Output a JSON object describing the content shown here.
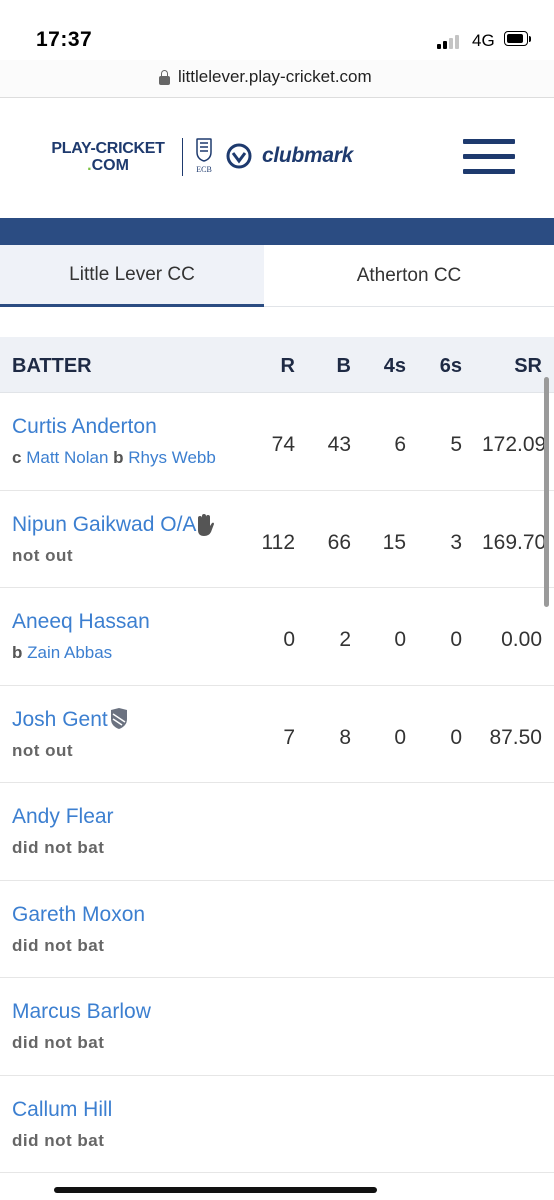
{
  "status_bar": {
    "time": "17:37",
    "network": "4G"
  },
  "browser": {
    "url": "littlelever.play-cricket.com"
  },
  "header": {
    "logo_line1": "PLAY-CRICKET",
    "logo_line2_dot": ".",
    "logo_line2": "COM",
    "ecb_text": "ECB",
    "clubmark_text": "clubmark"
  },
  "tabs": [
    {
      "label": "Little Lever CC",
      "active": true
    },
    {
      "label": "Atherton CC",
      "active": false
    }
  ],
  "table": {
    "headers": {
      "batter": "BATTER",
      "r": "R",
      "b": "B",
      "fours": "4s",
      "sixes": "6s",
      "sr": "SR"
    },
    "rows": [
      {
        "name": "Curtis Anderton",
        "dismissal": {
          "c_label": "c",
          "caught_by": "Matt Nolan",
          "b_label": "b",
          "bowler": "Rhys Webb"
        },
        "r": "74",
        "b": "43",
        "fours": "6",
        "sixes": "5",
        "sr": "172.09"
      },
      {
        "name": "Nipun Gaikwad O/A",
        "icon": "wicket-keeper-gloves-icon",
        "dismissal_text": "not out",
        "r": "112",
        "b": "66",
        "fours": "15",
        "sixes": "3",
        "sr": "169.70"
      },
      {
        "name": "Aneeq Hassan",
        "dismissal": {
          "b_label": "b",
          "bowler": "Zain Abbas"
        },
        "r": "0",
        "b": "2",
        "fours": "0",
        "sixes": "0",
        "sr": "0.00"
      },
      {
        "name": "Josh Gent",
        "icon": "captain-shield-icon",
        "dismissal_text": "not out",
        "r": "7",
        "b": "8",
        "fours": "0",
        "sixes": "0",
        "sr": "87.50"
      },
      {
        "name": "Andy Flear",
        "dismissal_text": "did not bat"
      },
      {
        "name": "Gareth Moxon",
        "dismissal_text": "did not bat"
      },
      {
        "name": "Marcus Barlow",
        "dismissal_text": "did not bat"
      },
      {
        "name": "Callum Hill",
        "dismissal_text": "did not bat"
      }
    ]
  },
  "colors": {
    "brand_navy": "#1e3a6e",
    "band_blue": "#2b4c82",
    "link_blue": "#3c7fd0",
    "accent_green": "#7cc142"
  }
}
